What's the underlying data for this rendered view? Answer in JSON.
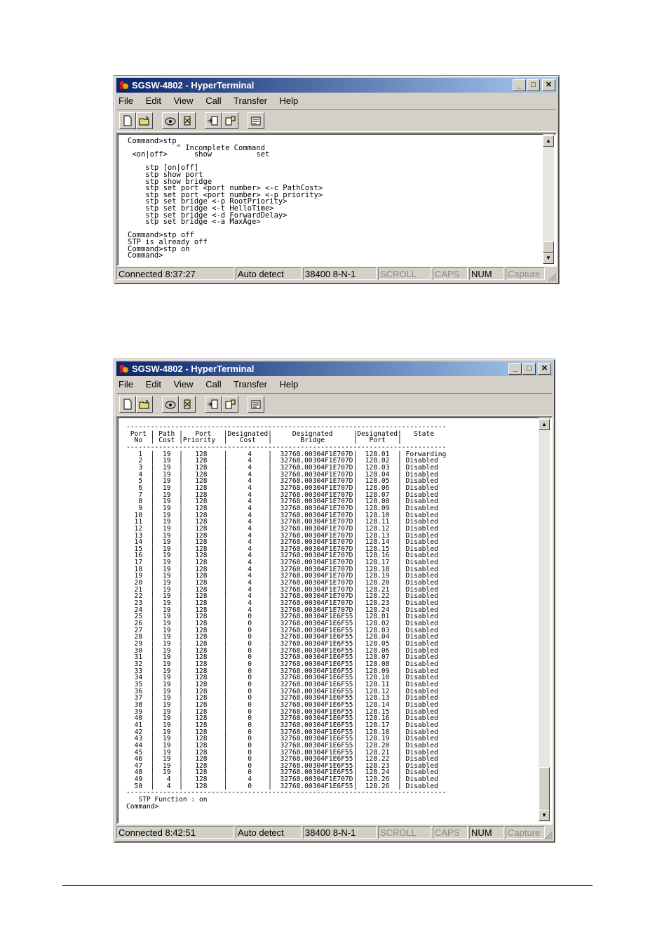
{
  "window1": {
    "title": "SGSW-4802 - HyperTerminal",
    "menu": [
      "File",
      "Edit",
      "View",
      "Call",
      "Transfer",
      "Help"
    ],
    "terminal_lines": [
      "Command>stp",
      "           ^ Incomplete Command",
      " <on|off>      show          set",
      "",
      "    stp [on|off]",
      "    stp show port",
      "    stp show bridge",
      "    stp set port <port number> <-c PathCost>",
      "    stp set port <port number> <-p priority>",
      "    stp set bridge <-p RootPriority>",
      "    stp set bridge <-t HelloTime>",
      "    stp set bridge <-d ForwardDelay>",
      "    stp set bridge <-a MaxAge>",
      "",
      "Command>stp off",
      "STP is already off",
      "Command>stp on",
      "Command>"
    ],
    "status": {
      "connected": "Connected 8:37:27",
      "detect": "Auto detect",
      "settings": "38400 8-N-1",
      "scroll": "SCROLL",
      "caps": "CAPS",
      "num": "NUM",
      "capture": "Capture"
    }
  },
  "window2": {
    "title": "SGSW-4802 - HyperTerminal",
    "menu": [
      "File",
      "Edit",
      "View",
      "Call",
      "Transfer",
      "Help"
    ],
    "terminal_lines": [
      "-------------------------------------------------------------------------------",
      " Port | Path |   Port   |Designated|     Designated     |Designated|   State",
      "  No  | Cost |Priority  |   Cost   |       Bridge       |   Port   |",
      "-------------------------------------------------------------------------------",
      "   1  |  19  |   128    |     4    |  32768.00304F1E707D|  128.01  | Forwarding",
      "   2  |  19  |   128    |     4    |  32768.00304F1E707D|  128.02  | Disabled",
      "   3  |  19  |   128    |     4    |  32768.00304F1E707D|  128.03  | Disabled",
      "   4  |  19  |   128    |     4    |  32768.00304F1E707D|  128.04  | Disabled",
      "   5  |  19  |   128    |     4    |  32768.00304F1E707D|  128.05  | Disabled",
      "   6  |  19  |   128    |     4    |  32768.00304F1E707D|  128.06  | Disabled",
      "   7  |  19  |   128    |     4    |  32768.00304F1E707D|  128.07  | Disabled",
      "   8  |  19  |   128    |     4    |  32768.00304F1E707D|  128.08  | Disabled",
      "   9  |  19  |   128    |     4    |  32768.00304F1E707D|  128.09  | Disabled",
      "  10  |  19  |   128    |     4    |  32768.00304F1E707D|  128.10  | Disabled",
      "  11  |  19  |   128    |     4    |  32768.00304F1E707D|  128.11  | Disabled",
      "  12  |  19  |   128    |     4    |  32768.00304F1E707D|  128.12  | Disabled",
      "  13  |  19  |   128    |     4    |  32768.00304F1E707D|  128.13  | Disabled",
      "  14  |  19  |   128    |     4    |  32768.00304F1E707D|  128.14  | Disabled",
      "  15  |  19  |   128    |     4    |  32768.00304F1E707D|  128.15  | Disabled",
      "  16  |  19  |   128    |     4    |  32768.00304F1E707D|  128.16  | Disabled",
      "  17  |  19  |   128    |     4    |  32768.00304F1E707D|  128.17  | Disabled",
      "  18  |  19  |   128    |     4    |  32768.00304F1E707D|  128.18  | Disabled",
      "  19  |  19  |   128    |     4    |  32768.00304F1E707D|  128.19  | Disabled",
      "  20  |  19  |   128    |     4    |  32768.00304F1E707D|  128.20  | Disabled",
      "  21  |  19  |   128    |     4    |  32768.00304F1E707D|  128.21  | Disabled",
      "  22  |  19  |   128    |     4    |  32768.00304F1E707D|  128.22  | Disabled",
      "  23  |  19  |   128    |     4    |  32768.00304F1E707D|  128.23  | Disabled",
      "  24  |  19  |   128    |     4    |  32768.00304F1E707D|  128.24  | Disabled",
      "  25  |  19  |   128    |     0    |  32768.00304F1E6F55|  128.01  | Disabled",
      "  26  |  19  |   128    |     0    |  32768.00304F1E6F55|  128.02  | Disabled",
      "  27  |  19  |   128    |     0    |  32768.00304F1E6F55|  128.03  | Disabled",
      "  28  |  19  |   128    |     0    |  32768.00304F1E6F55|  128.04  | Disabled",
      "  29  |  19  |   128    |     0    |  32768.00304F1E6F55|  128.05  | Disabled",
      "  30  |  19  |   128    |     0    |  32768.00304F1E6F55|  128.06  | Disabled",
      "  31  |  19  |   128    |     0    |  32768.00304F1E6F55|  128.07  | Disabled",
      "  32  |  19  |   128    |     0    |  32768.00304F1E6F55|  128.08  | Disabled",
      "  33  |  19  |   128    |     0    |  32768.00304F1E6F55|  128.09  | Disabled",
      "  34  |  19  |   128    |     0    |  32768.00304F1E6F55|  128.10  | Disabled",
      "  35  |  19  |   128    |     0    |  32768.00304F1E6F55|  128.11  | Disabled",
      "  36  |  19  |   128    |     0    |  32768.00304F1E6F55|  128.12  | Disabled",
      "  37  |  19  |   128    |     0    |  32768.00304F1E6F55|  128.13  | Disabled",
      "  38  |  19  |   128    |     0    |  32768.00304F1E6F55|  128.14  | Disabled",
      "  39  |  19  |   128    |     0    |  32768.00304F1E6F55|  128.15  | Disabled",
      "  40  |  19  |   128    |     0    |  32768.00304F1E6F55|  128.16  | Disabled",
      "  41  |  19  |   128    |     0    |  32768.00304F1E6F55|  128.17  | Disabled",
      "  42  |  19  |   128    |     0    |  32768.00304F1E6F55|  128.18  | Disabled",
      "  43  |  19  |   128    |     0    |  32768.00304F1E6F55|  128.19  | Disabled",
      "  44  |  19  |   128    |     0    |  32768.00304F1E6F55|  128.20  | Disabled",
      "  45  |  19  |   128    |     0    |  32768.00304F1E6F55|  128.21  | Disabled",
      "  46  |  19  |   128    |     0    |  32768.00304F1E6F55|  128.22  | Disabled",
      "  47  |  19  |   128    |     0    |  32768.00304F1E6F55|  128.23  | Disabled",
      "  48  |  19  |   128    |     0    |  32768.00304F1E6F55|  128.24  | Disabled",
      "  49  |   4  |   128    |     4    |  32768.00304F1E707D|  128.26  | Disabled",
      "  50  |   4  |   128    |     0    |  32768.00304F1E6F55|  128.26  | Disabled",
      "-------------------------------------------------------------------------------",
      "   STP Function : on",
      "Command>"
    ],
    "status": {
      "connected": "Connected 8:42:51",
      "detect": "Auto detect",
      "settings": "38400 8-N-1",
      "scroll": "SCROLL",
      "caps": "CAPS",
      "num": "NUM",
      "capture": "Capture"
    }
  },
  "icons": {
    "app": "hyperterminal-icon",
    "toolbar": [
      "new-icon",
      "open-icon",
      "connect-icon",
      "disconnect-icon",
      "send-icon",
      "receive-icon",
      "properties-icon"
    ]
  },
  "colors": {
    "title_start": "#0a246a",
    "title_end": "#a6caf0",
    "chrome": "#d4d0c8"
  }
}
